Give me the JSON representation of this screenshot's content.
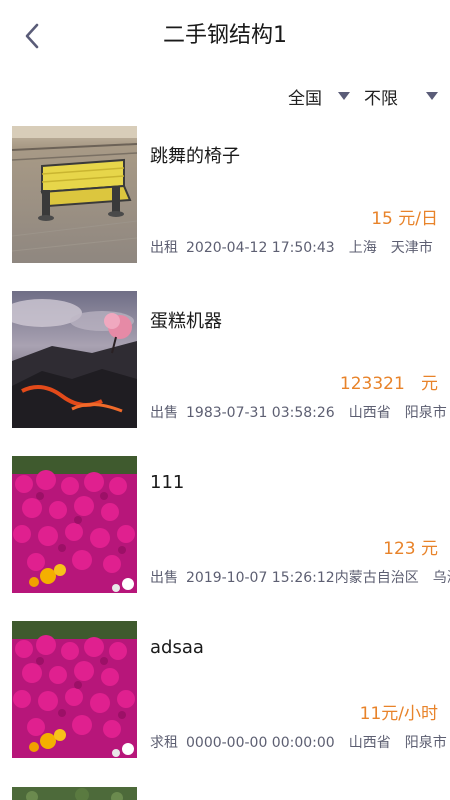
{
  "header": {
    "title": "二手钢结构1"
  },
  "filters": {
    "region": "全国",
    "limit": "不限"
  },
  "items": [
    {
      "title": "跳舞的椅子",
      "price": "15 元/日",
      "type": "出租",
      "datetime": "2020-04-12 17:50:43",
      "province": "上海",
      "city": "天津市",
      "thumb": "bench"
    },
    {
      "title": "蛋糕机器",
      "price": "123321   元",
      "type": "出售",
      "datetime": "1983-07-31 03:58:26",
      "province": "山西省",
      "city": "阳泉市",
      "thumb": "lava"
    },
    {
      "title": "111",
      "price": "123 元",
      "type": "出售",
      "datetime": "2019-10-07 15:26:12",
      "province": "内蒙古自治区",
      "city": "乌海",
      "thumb": "flowers"
    },
    {
      "title": "adsaa",
      "price": "11元/小时",
      "type": "求租",
      "datetime": "0000-00-00 00:00:00",
      "province": "山西省",
      "city": "阳泉市",
      "thumb": "flowers"
    }
  ],
  "colors": {
    "price": "#e8832a",
    "meta": "#5d5f72",
    "accent": "#5a5c78"
  }
}
